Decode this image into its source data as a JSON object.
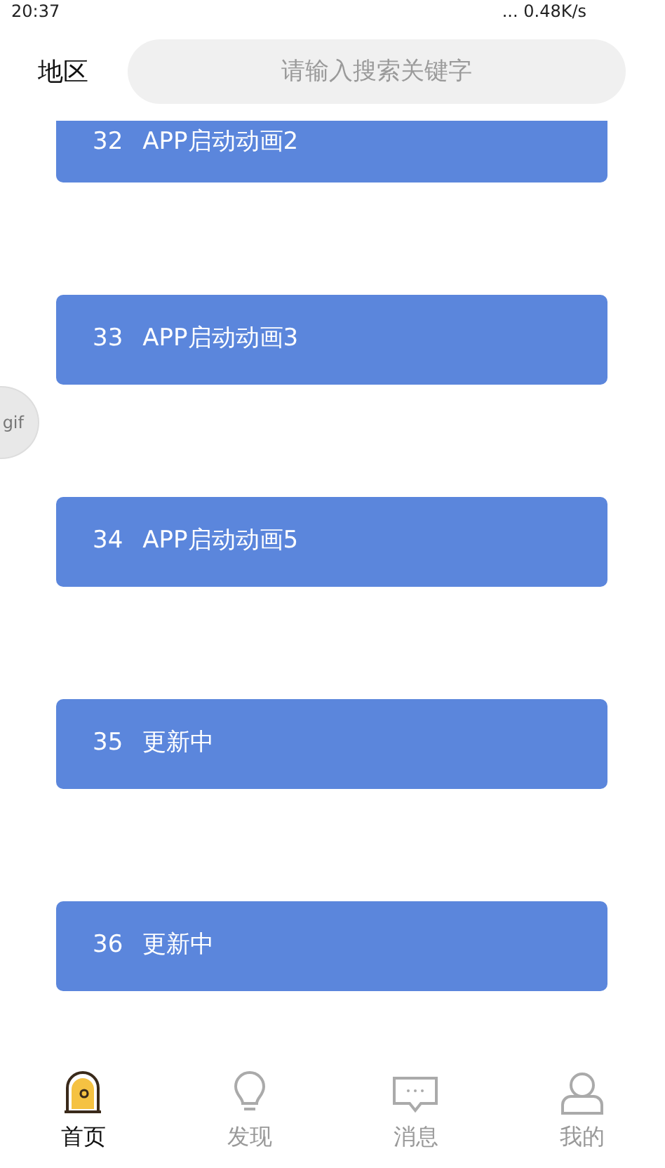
{
  "status_bar": {
    "time": "20:37",
    "speed": "... 0.48K/s"
  },
  "header": {
    "region": "地区",
    "search": {
      "placeholder": "请输入搜索关键字"
    }
  },
  "items": [
    {
      "number": "32",
      "title": "APP启动动画2"
    },
    {
      "number": "33",
      "title": "APP启动动画3"
    },
    {
      "number": "34",
      "title": "APP启动动画5"
    },
    {
      "number": "35",
      "title": "更新中"
    },
    {
      "number": "36",
      "title": "更新中"
    }
  ],
  "floating_badge": "gif",
  "tabs": [
    {
      "kind": "home",
      "label": "首页",
      "selected": true
    },
    {
      "kind": "discover",
      "label": "发现",
      "selected": false
    },
    {
      "kind": "message",
      "label": "消息",
      "selected": false
    },
    {
      "kind": "profile",
      "label": "我的",
      "selected": false
    }
  ]
}
